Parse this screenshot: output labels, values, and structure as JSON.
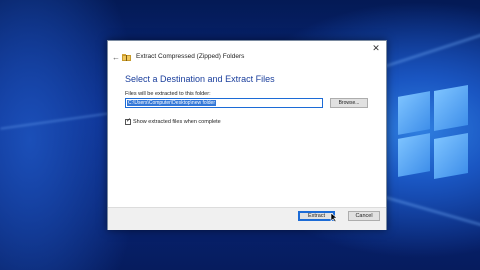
{
  "dialog": {
    "title": "Extract Compressed (Zipped) Folders",
    "heading": "Select a Destination and Extract Files",
    "field_label": "Files will be extracted to this folder:",
    "path_value": "C:\\Users\\Computer\\Desktop\\new folder",
    "browse_label": "Browse...",
    "checkbox_label": "Show extracted files when complete",
    "checkbox_checked": true,
    "extract_label": "Extract",
    "cancel_label": "Cancel",
    "close_glyph": "✕",
    "back_glyph": "←",
    "check_glyph": "✓"
  },
  "icons": {
    "dialog_icon": "zipped-folder-icon",
    "back": "back-arrow-icon",
    "close": "close-icon"
  },
  "colors": {
    "accent": "#1c6bd6",
    "heading": "#1a3e9c",
    "selection": "#3478d8"
  }
}
